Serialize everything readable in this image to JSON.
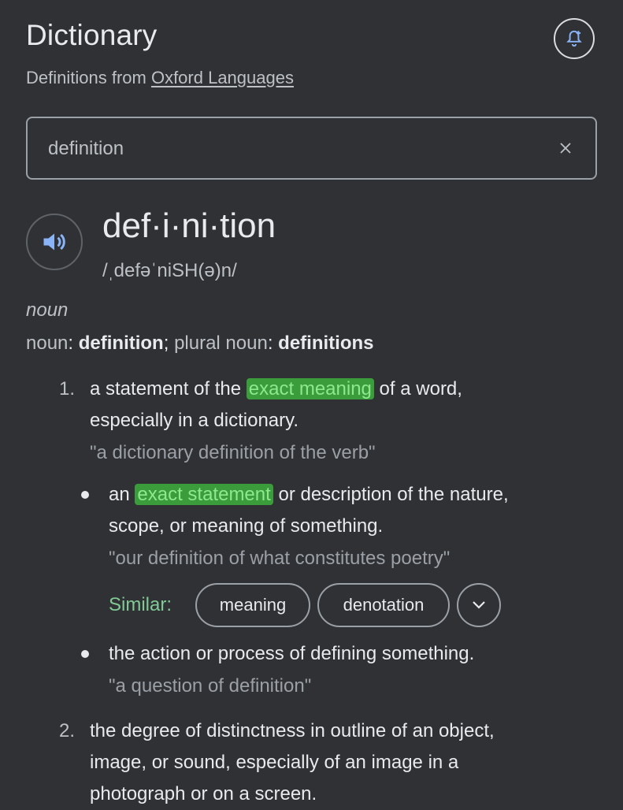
{
  "header": {
    "title": "Dictionary",
    "subtitle_prefix": "Definitions from ",
    "source_link": "Oxford Languages",
    "alert_icon": "bell-plus-icon"
  },
  "search": {
    "value": "definition",
    "clear_icon": "close-icon"
  },
  "entry": {
    "speaker_icon": "speaker-icon",
    "headword": "def·i·ni·tion",
    "phonetic": "/ˌdefəˈniSH(ə)n/",
    "part_of_speech": "noun",
    "forms": {
      "label1": "noun",
      "colon": ":",
      "word1": "definition",
      "sep": ";",
      "label2": "plural noun",
      "word2": "definitions"
    }
  },
  "senses": {
    "s1": {
      "number": "1.",
      "pre": "a statement of the ",
      "highlight": "exact meaning",
      "post": " of a word,",
      "line2": "especially in a dictionary.",
      "example": "\"a dictionary definition of the verb\""
    },
    "sub1": {
      "pre": "an ",
      "highlight": "exact statement",
      "post": " or description of the nature,",
      "line2": "scope, or meaning of something.",
      "example": "\"our definition of what constitutes poetry\""
    },
    "similar": {
      "label": "Similar:",
      "chips": [
        "meaning",
        "denotation"
      ],
      "expand_icon": "chevron-down-icon"
    },
    "sub2": {
      "text": "the action or process of defining something.",
      "example": "\"a question of definition\""
    },
    "s2": {
      "number": "2.",
      "line1": "the degree of distinctness in outline of an object,",
      "line2": "image, or sound, especially of an image in a",
      "line3": "photograph or on a screen."
    }
  },
  "colors": {
    "background": "#303134",
    "highlight": "#3a9c3a",
    "similar": "#81c995"
  }
}
